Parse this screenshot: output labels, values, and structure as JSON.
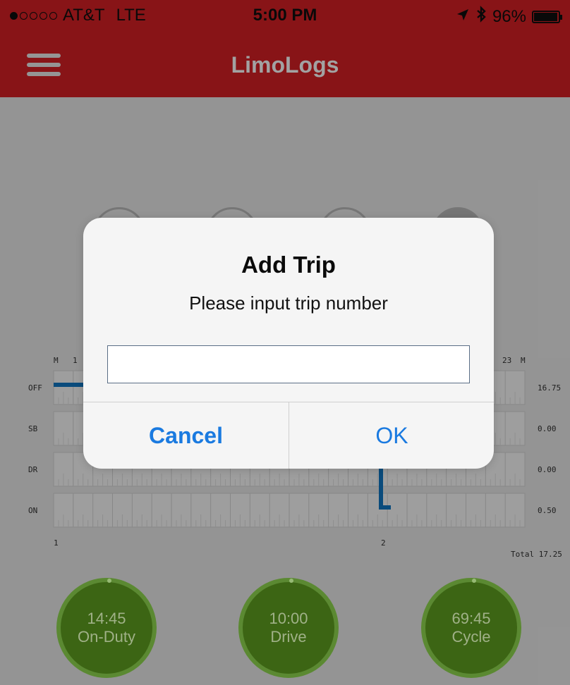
{
  "status_bar": {
    "carrier": "AT&T",
    "network": "LTE",
    "time": "5:00 PM",
    "battery": "96%",
    "battery_level": 0.96,
    "signal_filled": 1,
    "signal_total": 5
  },
  "navbar": {
    "title": "LimoLogs",
    "menu_icon": "hamburger-icon"
  },
  "log_grid": {
    "top_labels": [
      "M",
      "1",
      "23",
      "M"
    ],
    "row_labels": [
      "OFF",
      "SB",
      "DR",
      "ON"
    ],
    "row_totals": [
      "16.75",
      "0.00",
      "0.00",
      "0.50"
    ],
    "bottom_labels": [
      "1",
      "2"
    ],
    "total_label": "Total 17.25"
  },
  "dialog": {
    "title": "Add Trip",
    "message": "Please input trip number",
    "input_value": "",
    "input_placeholder": "",
    "cancel_label": "Cancel",
    "ok_label": "OK"
  },
  "timers": [
    {
      "time": "14:45",
      "label": "On-Duty"
    },
    {
      "time": "10:00",
      "label": "Drive"
    },
    {
      "time": "69:45",
      "label": "Cycle"
    }
  ],
  "colors": {
    "header_red": "#8e1518",
    "accent_blue": "#1a7ae0",
    "timer_green": "#3f6a15",
    "graph_line": "#0b4f82"
  }
}
